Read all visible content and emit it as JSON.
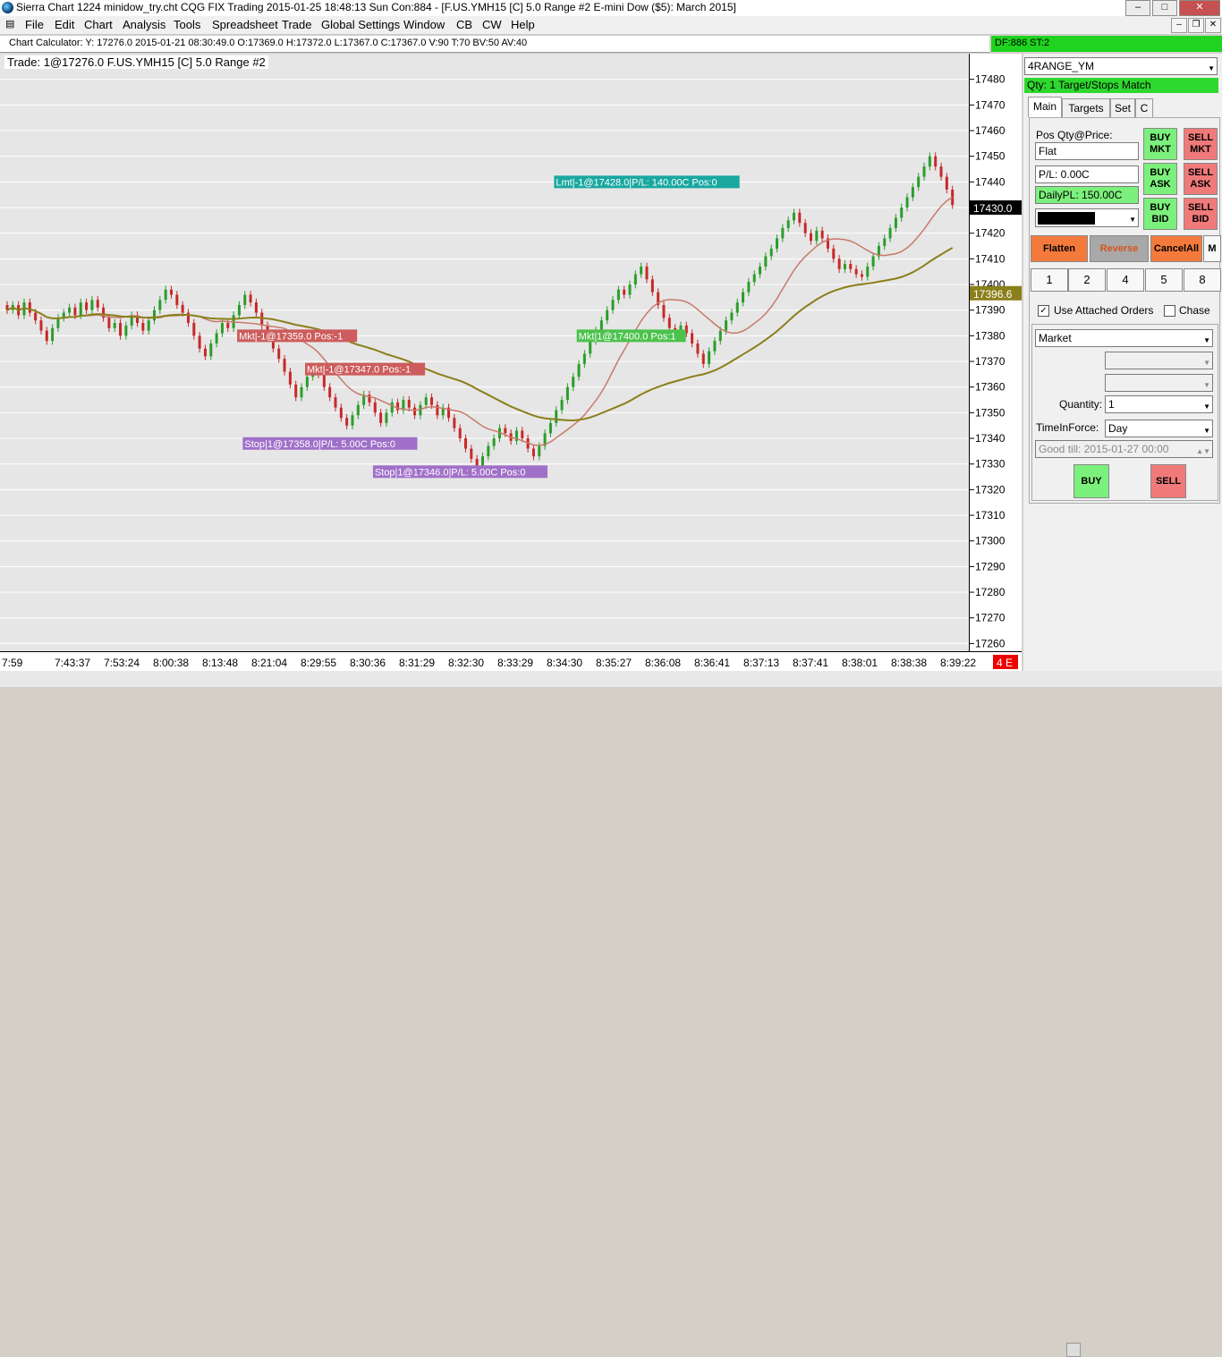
{
  "window": {
    "title": "Sierra Chart 1224 minidow_try.cht  CQG FIX Trading 2015-01-25  18:48:13 Sun  Con:884 - [F.US.YMH15 [C]  5.0 Range  #2  E-mini Dow ($5): March 2015]",
    "minimize": "–",
    "maximize": "□",
    "close": "✕",
    "mdi_min": "–",
    "mdi_restore": "❐",
    "mdi_close": "✕"
  },
  "menu": [
    "File",
    "Edit",
    "Chart",
    "Analysis",
    "Tools",
    "Spreadsheet",
    "Trade",
    "Global Settings",
    "Window",
    "CB",
    "CW",
    "Help"
  ],
  "calc_bar": "Chart Calculator: Y: 17276.0  2015-01-21  08:30:49.0  O:17369.0  H:17372.0  L:17367.0  C:17367.0  V:90  T:70  BV:50  AV:40",
  "df_bar": "DF:886  ST:2",
  "chart_header": {
    "trade": "Trade: 1@17276.0",
    "symbol": "F.US.YMH15 [C]  5.0 Range  #2"
  },
  "chart_data": {
    "type": "candlestick",
    "y_ticks": [
      17480,
      17470,
      17460,
      17450,
      17440,
      17430,
      17420,
      17410,
      17400,
      17390,
      17380,
      17370,
      17360,
      17350,
      17340,
      17330,
      17320,
      17310,
      17300,
      17290,
      17280,
      17270,
      17260
    ],
    "ylim": [
      17257,
      17490
    ],
    "x_labels": [
      "7:59",
      "7:43:37",
      "7:53:24",
      "8:00:38",
      "8:13:48",
      "8:21:04",
      "8:29:55",
      "8:30:36",
      "8:31:29",
      "8:32:30",
      "8:33:29",
      "8:34:30",
      "8:35:27",
      "8:36:08",
      "8:36:41",
      "8:37:13",
      "8:37:41",
      "8:38:01",
      "8:38:38",
      "8:39:22"
    ],
    "closes": [
      17390,
      17392,
      17388,
      17393,
      17389,
      17386,
      17382,
      17378,
      17383,
      17387,
      17389,
      17391,
      17388,
      17393,
      17390,
      17394,
      17391,
      17387,
      17383,
      17385,
      17380,
      17384,
      17388,
      17385,
      17382,
      17386,
      17390,
      17394,
      17398,
      17396,
      17392,
      17389,
      17385,
      17380,
      17375,
      17372,
      17377,
      17381,
      17385,
      17383,
      17388,
      17392,
      17396,
      17393,
      17389,
      17384,
      17380,
      17375,
      17371,
      17366,
      17361,
      17356,
      17360,
      17364,
      17368,
      17365,
      17360,
      17356,
      17352,
      17348,
      17345,
      17349,
      17353,
      17357,
      17354,
      17350,
      17346,
      17350,
      17354,
      17351,
      17355,
      17352,
      17349,
      17353,
      17356,
      17353,
      17349,
      17352,
      17348,
      17344,
      17340,
      17336,
      17332,
      17329,
      17333,
      17337,
      17340,
      17344,
      17342,
      17339,
      17343,
      17340,
      17336,
      17333,
      17337,
      17342,
      17346,
      17351,
      17355,
      17360,
      17364,
      17369,
      17373,
      17378,
      17382,
      17386,
      17390,
      17394,
      17398,
      17396,
      17400,
      17404,
      17407,
      17402,
      17397,
      17392,
      17387,
      17383,
      17380,
      17384,
      17381,
      17377,
      17373,
      17369,
      17374,
      17378,
      17382,
      17386,
      17389,
      17393,
      17397,
      17401,
      17404,
      17407,
      17411,
      17414,
      17418,
      17422,
      17425,
      17428,
      17424,
      17420,
      17417,
      17421,
      17418,
      17414,
      17410,
      17406,
      17408,
      17406,
      17404,
      17403,
      17407,
      17411,
      17415,
      17418,
      17422,
      17426,
      17430,
      17434,
      17438,
      17442,
      17446,
      17450,
      17446,
      17442,
      17437,
      17431
    ],
    "last_price": "17430.0",
    "ma_label": "17396.6",
    "annotations": [
      {
        "text": "Mkt|-1@17359.0 Pos:-1",
        "color": "#cd5c5c"
      },
      {
        "text": "Mkt|-1@17347.0 Pos:-1",
        "color": "#cd5c5c"
      },
      {
        "text": "Stop|1@17358.0|P/L: 5.00C Pos:0",
        "color": "#a070c8"
      },
      {
        "text": "Stop|1@17346.0|P/L: 5.00C Pos:0",
        "color": "#a070c8"
      },
      {
        "text": "Lmt|-1@17428.0|P/L: 140.00C Pos:0",
        "color": "#18a8a0"
      },
      {
        "text": "Mkt|1@17400.0 Pos:1",
        "color": "#4cc24c"
      }
    ],
    "up_color": "#2a9d2a",
    "down_color": "#c82828",
    "ma_fast_color": "#c87a6a",
    "ma_slow_color": "#8a7f1a"
  },
  "xaxis_badge": "4 E",
  "panel": {
    "symbol_select": "4RANGE_YM",
    "qty_status": "Qty: 1 Target/Stops Match",
    "tabs": [
      "Main",
      "Targets",
      "Set",
      "C"
    ],
    "pos_label": "Pos Qty@Price:",
    "pos_value": "Flat",
    "pl_value": "P/L: 0.00C",
    "daily_pl": "DailyPL: 150.00C",
    "buy_mkt": "BUY MKT",
    "sell_mkt": "SELL MKT",
    "buy_ask": "BUY ASK",
    "sell_ask": "SELL ASK",
    "buy_bid": "BUY BID",
    "sell_bid": "SELL BID",
    "flatten": "Flatten",
    "reverse": "Reverse",
    "cancel_all": "CancelAll",
    "m_btn": "M",
    "qty_buttons": [
      "1",
      "2",
      "4",
      "5",
      "8"
    ],
    "use_attached": "Use Attached Orders",
    "chase": "Chase",
    "order_type": "Market",
    "quantity_label": "Quantity:",
    "quantity": "1",
    "tif_label": "TimeInForce:",
    "tif": "Day",
    "good_till": "Good till: 2015-01-27 00:00",
    "buy": "BUY",
    "sell": "SELL"
  }
}
